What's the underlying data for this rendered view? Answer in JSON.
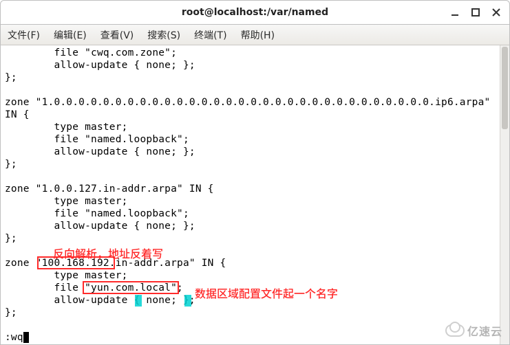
{
  "window": {
    "title": "root@localhost:/var/named"
  },
  "menu": {
    "file": "文件(F)",
    "edit": "编辑(E)",
    "view": "查看(V)",
    "search": "搜索(S)",
    "terminal": "终端(T)",
    "help": "帮助(H)"
  },
  "code": {
    "l01": "        file \"cwq.com.zone\";",
    "l02": "        allow-update { none; };",
    "l03": "};",
    "l04": "",
    "l05": "zone \"1.0.0.0.0.0.0.0.0.0.0.0.0.0.0.0.0.0.0.0.0.0.0.0.0.0.0.0.0.0.0.0.ip6.arpa\"",
    "l06": "IN {",
    "l07": "        type master;",
    "l08": "        file \"named.loopback\";",
    "l09": "        allow-update { none; };",
    "l10": "};",
    "l11": "",
    "l12": "zone \"1.0.0.127.in-addr.arpa\" IN {",
    "l13": "        type master;",
    "l14": "        file \"named.loopback\";",
    "l15": "        allow-update { none; };",
    "l16": "};",
    "l17": "",
    "l18": "zone \"100.168.192.in-addr.arpa\" IN {",
    "l19": "        type master;",
    "l20": "        file \"yun.com.local\";",
    "l21": "        allow-update { none; };",
    "l22": "};",
    "l23": "",
    "l24": ":wq"
  },
  "annotations": {
    "a1": "反向解析，地址反着写",
    "a2": "数据区域配置文件起一个名字"
  },
  "watermark": "亿速云"
}
